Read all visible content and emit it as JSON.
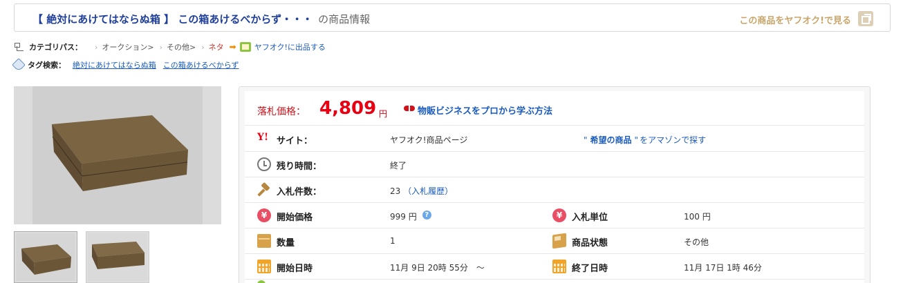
{
  "header": {
    "title": "【 絶対にあけてはならぬ箱 】 この箱あけるべからず・・・",
    "title_suffix": "の商品情報",
    "yahoo_link": "この商品をヤフオク!で見る"
  },
  "breadcrumb": {
    "label": "カテゴリパス：",
    "items": [
      "オークション>",
      "その他>",
      "ネタ"
    ],
    "sell_link": "ヤフオク!に出品する"
  },
  "tags": {
    "label": "タグ検索：",
    "items": [
      "絶対にあけてはならぬ箱",
      "この箱あけるべからず"
    ]
  },
  "price": {
    "label": "落札価格：",
    "value": "4,809",
    "unit": "円",
    "biz_link": "物販ビジネスをプロから学ぶ方法"
  },
  "site": {
    "label": "サイト：",
    "link": "ヤフオク!商品ページ",
    "amazon_quote_open": "\"",
    "amazon_keyword": "希望の商品",
    "amazon_quote_close": "\"",
    "amazon_suffix": "をアマゾンで探す"
  },
  "time_left": {
    "label": "残り時間：",
    "value": "終了"
  },
  "bids": {
    "label": "入札件数：",
    "count": "23",
    "history": "（入札履歴）"
  },
  "start_price": {
    "label": "開始価格",
    "value": "999 円"
  },
  "bid_unit": {
    "label": "入札単位",
    "value": "100 円"
  },
  "quantity": {
    "label": "数量",
    "value": "1"
  },
  "condition": {
    "label": "商品状態",
    "value": "その他"
  },
  "start_date": {
    "label": "開始日時",
    "value": "11月 9日 20時 55分　〜"
  },
  "end_date": {
    "label": "終了日時",
    "value": "11月 17日 1時 46分"
  },
  "colors": {
    "title_blue": "#1f3f9a",
    "price_red": "#e60012",
    "link_blue": "#1a5bbd",
    "yahoo_gold": "#c8a56a"
  }
}
